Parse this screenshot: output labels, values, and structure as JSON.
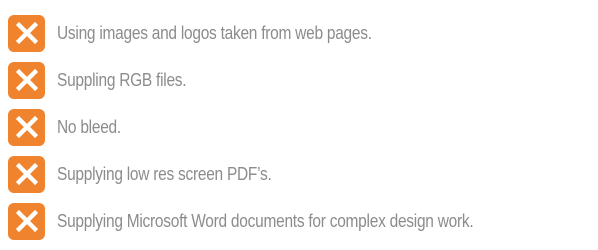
{
  "colors": {
    "badge": "#f0832e",
    "cross": "#ffffff",
    "text": "#8c8c8c"
  },
  "items": [
    {
      "icon": "cross-icon",
      "label": "Using images and logos taken from web pages."
    },
    {
      "icon": "cross-icon",
      "label": "Suppling RGB files."
    },
    {
      "icon": "cross-icon",
      "label": "No bleed."
    },
    {
      "icon": "cross-icon",
      "label": "Supplying low res screen PDF’s."
    },
    {
      "icon": "cross-icon",
      "label": "Supplying Microsoft Word documents for complex design work."
    }
  ]
}
